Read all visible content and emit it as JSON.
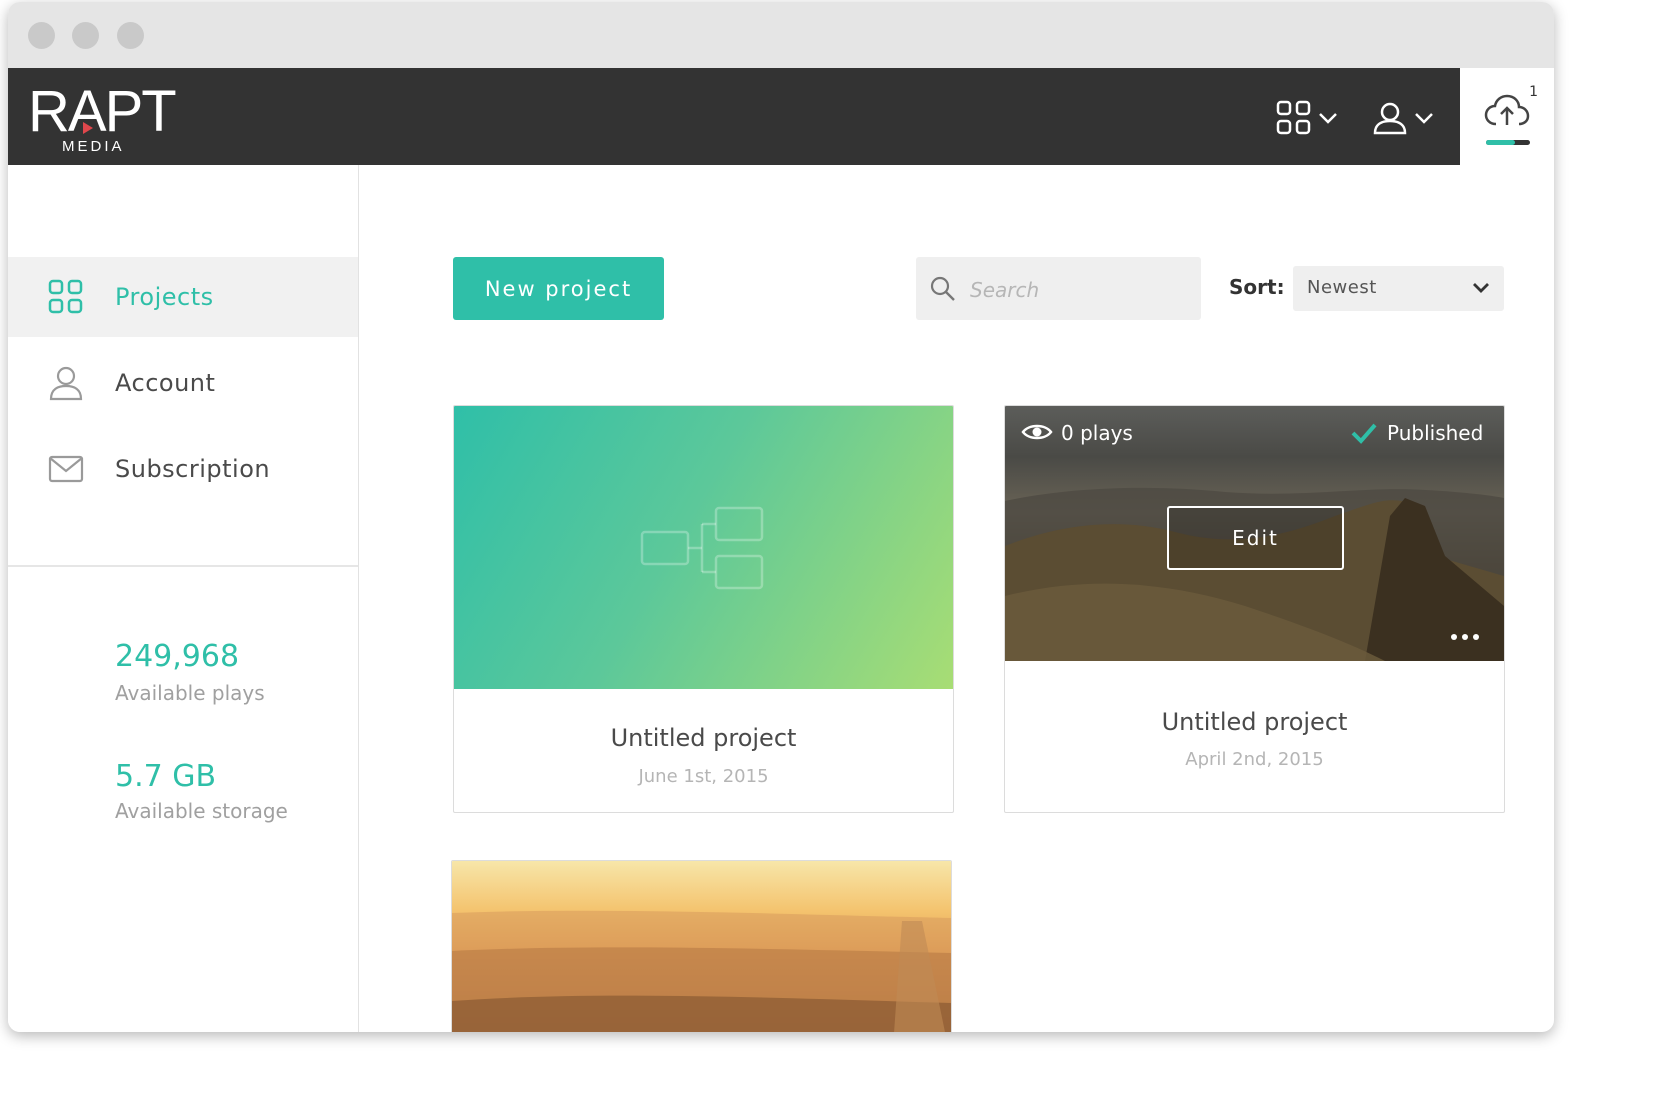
{
  "app": {
    "logo_text": "RAPT",
    "logo_sub": "MEDIA",
    "upload_count": "1"
  },
  "topnav": {
    "apps_icon": "grid-icon",
    "user_icon": "user-icon",
    "upload_icon": "cloud-upload-icon",
    "upload_progress": 0.65
  },
  "sidebar": {
    "items": [
      {
        "label": "Projects",
        "icon": "grid-icon",
        "active": true
      },
      {
        "label": "Account",
        "icon": "user-icon",
        "active": false
      },
      {
        "label": "Subscription",
        "icon": "envelope-icon",
        "active": false
      }
    ],
    "stats": [
      {
        "value": "249,968",
        "label": "Available plays"
      },
      {
        "value": "5.7 GB",
        "label": "Available storage"
      }
    ]
  },
  "toolbar": {
    "new_project_label": "New project",
    "search_placeholder": "Search",
    "sort_label": "Sort:",
    "sort_value": "Newest"
  },
  "projects": [
    {
      "title": "Untitled project",
      "date": "June 1st, 2015"
    },
    {
      "title": "Untitled project",
      "date": "April 2nd, 2015",
      "plays": "0 plays",
      "status": "Published",
      "edit_label": "Edit"
    },
    {
      "title": "",
      "date": ""
    }
  ],
  "colors": {
    "accent": "#2fbfa8",
    "topbar": "#333333",
    "sidebar_active_bg": "#f1f1f1"
  }
}
